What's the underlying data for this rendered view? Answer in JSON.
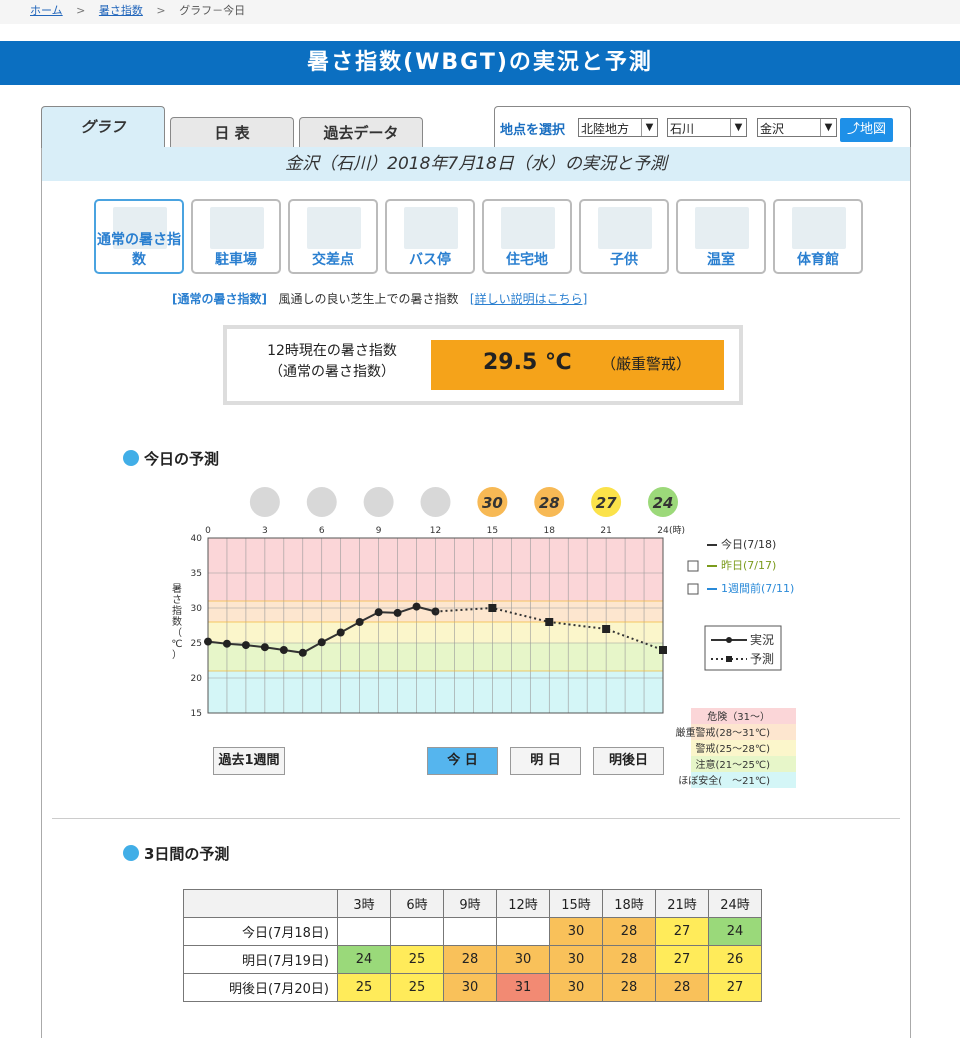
{
  "breadcrumb": {
    "home": "ホーム",
    "wbgt": "暑さ指数",
    "current": "グラフ－今日",
    "sep": ">"
  },
  "page_title": "暑さ指数(WBGT)の実況と予測",
  "tabs": {
    "graph": "グラフ",
    "daily": "日 表",
    "past": "過去データ"
  },
  "location": {
    "label": "地点を選択",
    "region": "北陸地方",
    "prefecture": "石川",
    "city": "金沢",
    "map_button": "地図"
  },
  "date_title": "金沢（石川）2018年7月18日（水）の実況と予測",
  "categories": [
    {
      "label": "通常の暑さ指数",
      "selected": true
    },
    {
      "label": "駐車場"
    },
    {
      "label": "交差点"
    },
    {
      "label": "バス停"
    },
    {
      "label": "住宅地"
    },
    {
      "label": "子供"
    },
    {
      "label": "温室"
    },
    {
      "label": "体育館"
    }
  ],
  "description": {
    "category": "[通常の暑さ指数]",
    "text": "風通しの良い芝生上での暑さ指数",
    "link": "[詳しい説明はこちら]"
  },
  "current": {
    "label_line1": "12時現在の暑さ指数",
    "label_line2": "（通常の暑さ指数）",
    "value": "29.5 ℃",
    "level": "（厳重警戒）"
  },
  "sections": {
    "today_forecast": "今日の予測",
    "three_day": "3日間の予測"
  },
  "buttons": {
    "past_week": "過去1週間",
    "today": "今 日",
    "tomorrow": "明 日",
    "day_after": "明後日"
  },
  "legend": {
    "today": "今日(7/18)",
    "yesterday": "昨日(7/17)",
    "week_ago": "1週間前(7/11)",
    "actual": "実況",
    "forecast": "予測"
  },
  "levels": [
    {
      "label": "危険（31～）",
      "color": "#fbd6d8"
    },
    {
      "label": "厳重警戒(28～31℃)",
      "color": "#fde6cf"
    },
    {
      "label": "警戒(25～28℃)",
      "color": "#fbf6cb"
    },
    {
      "label": "注意(21～25℃)",
      "color": "#e7f6c9"
    },
    {
      "label": "ほぼ安全(　～21℃)",
      "color": "#d4f6f7"
    }
  ],
  "bubbles": [
    {
      "hour": 15,
      "value": "30",
      "color": "#f7b955"
    },
    {
      "hour": 18,
      "value": "28",
      "color": "#f7b955"
    },
    {
      "hour": 21,
      "value": "27",
      "color": "#fbe24a"
    },
    {
      "hour": 24,
      "value": "24",
      "color": "#9cd97a"
    }
  ],
  "chart_data": {
    "type": "line",
    "ylabel": "暑さ指数（℃）",
    "ylim": [
      15,
      40
    ],
    "xlim": [
      0,
      24
    ],
    "x_ticks": [
      "0",
      "3",
      "6",
      "9",
      "12",
      "15",
      "18",
      "21",
      "24"
    ],
    "x_unit": "(時)",
    "y_ticks": [
      "15",
      "20",
      "25",
      "30",
      "35",
      "40"
    ],
    "series": [
      {
        "name": "実況",
        "x": [
          0,
          1,
          2,
          3,
          4,
          5,
          6,
          7,
          8,
          9,
          10,
          11,
          12
        ],
        "values": [
          25.2,
          24.9,
          24.7,
          24.4,
          24.0,
          23.6,
          25.1,
          26.5,
          28.0,
          29.4,
          29.3,
          30.2,
          29.5
        ]
      },
      {
        "name": "予測",
        "x": [
          12,
          15,
          18,
          21,
          24
        ],
        "values": [
          29.5,
          30.0,
          28.0,
          27.0,
          24.0
        ]
      }
    ]
  },
  "table": {
    "headers": [
      "3時",
      "6時",
      "9時",
      "12時",
      "15時",
      "18時",
      "21時",
      "24時"
    ],
    "rows": [
      {
        "label": "今日(7月18日)",
        "cells": [
          "",
          "",
          "",
          "",
          "30",
          "28",
          "27",
          "24"
        ],
        "classes": [
          "",
          "",
          "",
          "",
          "c28",
          "c28",
          "c24",
          "cg"
        ]
      },
      {
        "label": "明日(7月19日)",
        "cells": [
          "24",
          "25",
          "28",
          "30",
          "30",
          "28",
          "27",
          "26"
        ],
        "classes": [
          "cg",
          "c24",
          "c28",
          "c28",
          "c28",
          "c28",
          "c24",
          "c24"
        ]
      },
      {
        "label": "明後日(7月20日)",
        "cells": [
          "25",
          "25",
          "30",
          "31",
          "30",
          "28",
          "28",
          "27"
        ],
        "classes": [
          "c24",
          "c24",
          "c28",
          "c31",
          "c28",
          "c28",
          "c28",
          "c24"
        ]
      }
    ]
  }
}
